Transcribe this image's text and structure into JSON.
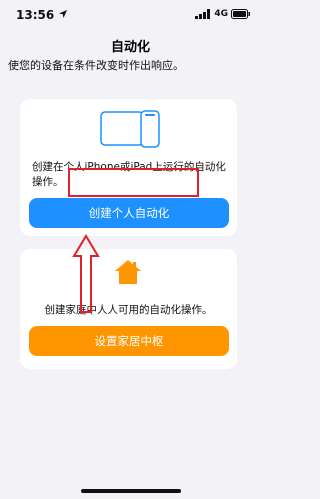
{
  "status_bar": {
    "time": "13:56",
    "network": "4G"
  },
  "nav": {
    "title": "自动化"
  },
  "intro_text": "使您的设备在条件改变时作出响应。",
  "personal_card": {
    "description": "创建在个人iPhone或iPad上运行的自动化操作。",
    "button_label": "创建个人自动化"
  },
  "home_card": {
    "description": "创建家庭中人人可用的自动化操作。",
    "button_label": "设置家居中枢"
  },
  "colors": {
    "accent_blue": "#1e90ff",
    "accent_orange": "#ff9500",
    "annotation_red": "#e0202a",
    "background": "#f2f2f7"
  }
}
